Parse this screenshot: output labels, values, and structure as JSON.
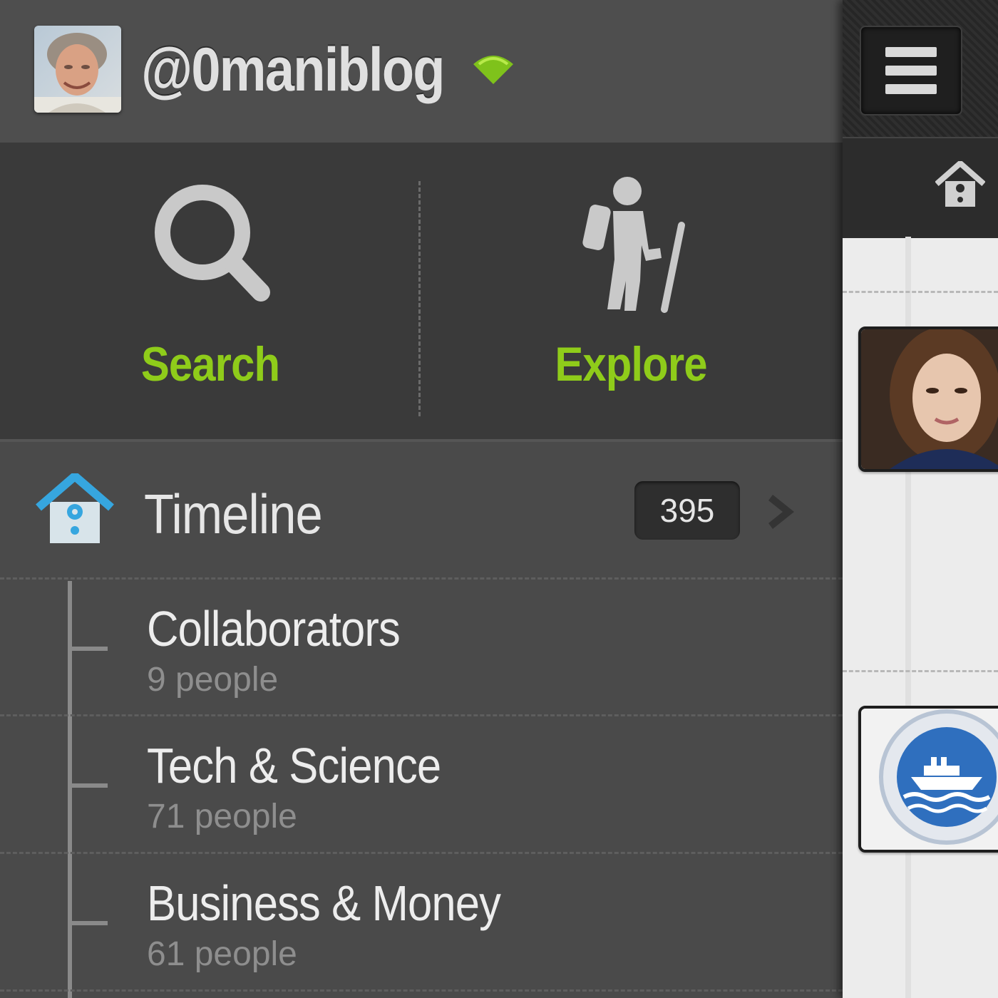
{
  "account": {
    "username": "@0maniblog",
    "avatar": "profile-photo",
    "status_icon": "signal-icon",
    "status_color": "#7fc21b"
  },
  "actions": {
    "search": {
      "label": "Search",
      "icon": "magnifier-icon"
    },
    "explore": {
      "label": "Explore",
      "icon": "hiker-icon"
    },
    "label_color": "#8fcc1a"
  },
  "timeline": {
    "label": "Timeline",
    "count": "395",
    "icon": "birdhouse-icon",
    "accent_color": "#36a6df"
  },
  "lists": [
    {
      "title": "Collaborators",
      "count": "9 people"
    },
    {
      "title": "Tech & Science",
      "count": "71 people"
    },
    {
      "title": "Business & Money",
      "count": "61 people"
    }
  ],
  "content_peek": {
    "menu_icon": "hamburger-menu-icon",
    "home_icon": "birdhouse-icon",
    "avatars": [
      "woman-portrait-avatar",
      "cruise-ship-badge-avatar"
    ]
  }
}
